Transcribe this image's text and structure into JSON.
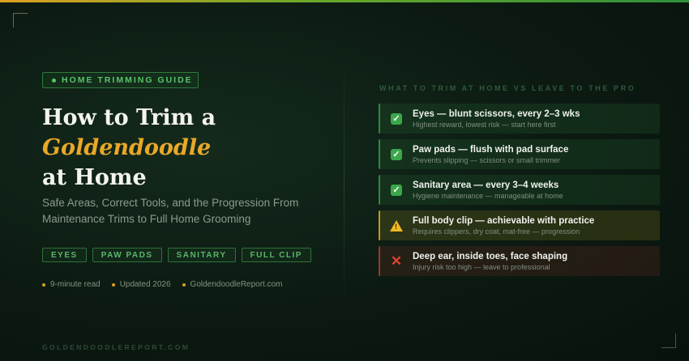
{
  "kicker": "HOME TRIMMING GUIDE",
  "title": {
    "line1": "How to Trim a",
    "accent": "Goldendoodle",
    "line3": "at Home"
  },
  "subtitle": "Safe Areas, Correct Tools, and the Progression From Maintenance Trims to Full Home Grooming",
  "tags": [
    "EYES",
    "PAW PADS",
    "SANITARY",
    "FULL CLIP"
  ],
  "meta": [
    "9-minute read",
    "Updated 2026",
    "GoldendoodleReport.com"
  ],
  "footer": "GOLDENDOODLEREPORT.COM",
  "panel": {
    "heading": "WHAT TO TRIM AT HOME VS LEAVE TO THE PRO",
    "rows": [
      {
        "status": "ok",
        "icon": "check-icon",
        "title": "Eyes — blunt scissors, every 2–3 wks",
        "subtitle": "Highest reward, lowest risk — start here first"
      },
      {
        "status": "ok",
        "icon": "check-icon",
        "title": "Paw pads — flush with pad surface",
        "subtitle": "Prevents slipping — scissors or small trimmer"
      },
      {
        "status": "ok",
        "icon": "check-icon",
        "title": "Sanitary area — every 3–4 weeks",
        "subtitle": "Hygiene maintenance — manageable at home"
      },
      {
        "status": "warn",
        "icon": "warning-icon",
        "title": "Full body clip — achievable with practice",
        "subtitle": "Requires clippers, dry coat, mat-free — progression"
      },
      {
        "status": "stop",
        "icon": "cross-icon",
        "title": "Deep ear, inside toes, face shaping",
        "subtitle": "Injury risk too high — leave to professional"
      }
    ]
  },
  "colors": {
    "accent_gold": "#e8a828",
    "green": "#58c46a",
    "warn": "#f0b824",
    "stop": "#e0412e"
  }
}
